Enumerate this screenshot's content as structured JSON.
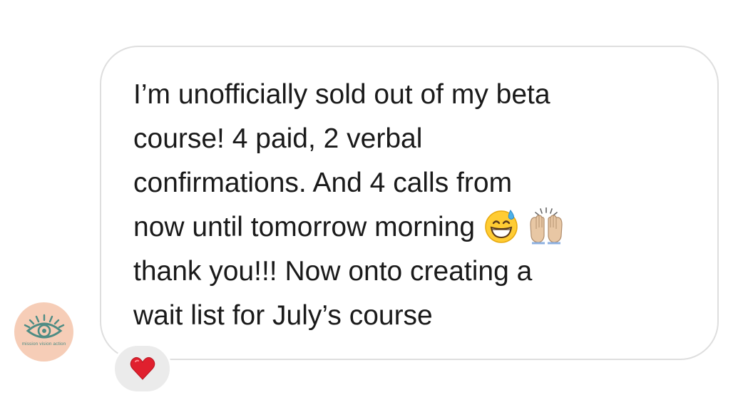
{
  "message": {
    "lines": [
      "I’m unofficially sold out of my beta",
      "course! 4 paid, 2 verbal",
      "confirmations. And 4 calls from",
      "now until tomorrow morning",
      "thank you!!! Now onto creating a",
      "wait list for July’s course"
    ],
    "emojis": [
      "grinning-face-with-sweat-icon",
      "raising-hands-icon"
    ]
  },
  "avatar": {
    "caption": "mission vision action",
    "icon": "eye-logo-icon"
  },
  "reaction": {
    "icon": "red-heart-icon"
  },
  "colors": {
    "bubble_border": "#dedede",
    "text": "#1a1a1a",
    "avatar_background": "#f6cdb7",
    "avatar_logo": "#4e8c84",
    "reaction_background": "#ebebeb",
    "heart": "#e0202e"
  }
}
